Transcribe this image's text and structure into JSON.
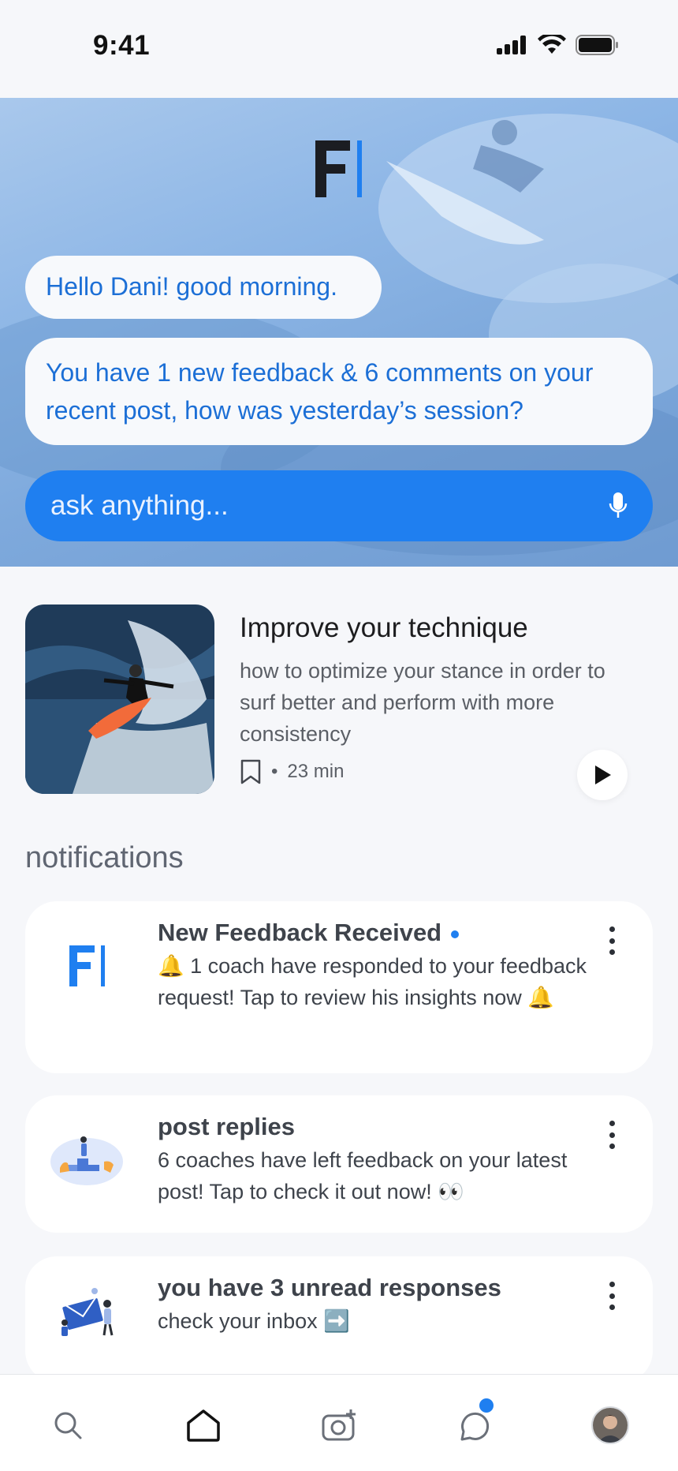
{
  "status": {
    "time": "9:41"
  },
  "hero": {
    "greeting": "Hello Dani! good morning.",
    "message": "You have 1 new feedback & 6 comments on your recent post, how was yesterday’s session?",
    "ask_placeholder": "ask anything..."
  },
  "feature": {
    "title": "Improve your technique",
    "description": "how to optimize your stance in order to surf better and perform with more consistency",
    "separator": "•",
    "duration": "23 min"
  },
  "notifications": {
    "section_title": "notifications",
    "items": [
      {
        "title": "New Feedback Received",
        "text_start": "🔔",
        "text": " 1 coach have responded to your feedback request! Tap to review his insights now ",
        "text_end": "🔔"
      },
      {
        "title": "post replies",
        "text": "6 coaches have left feedback on your latest post! Tap to check it out now! 👀"
      },
      {
        "title": "you have 3 unread responses",
        "text": "check your inbox ➡️"
      }
    ]
  },
  "colors": {
    "accent": "#1f7ff0",
    "hero_bg": "#8db6e6",
    "bubble_text": "#1c6fd6"
  },
  "icons": [
    "search-icon",
    "home-icon",
    "camera-add-icon",
    "chat-icon",
    "avatar",
    "mic-icon",
    "bookmark-icon",
    "play-icon",
    "more-vertical-icon"
  ]
}
